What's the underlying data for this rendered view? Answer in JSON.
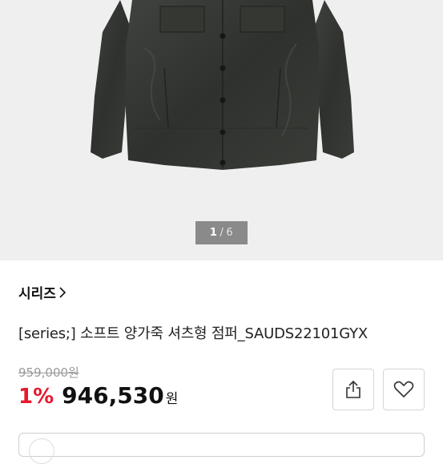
{
  "gallery": {
    "current": "1",
    "separator": "/",
    "total": "6",
    "image_subject": "charcoal leather shirt jacket"
  },
  "product": {
    "series_label": "시리즈",
    "title": "[series;] 소프트 양가죽 셔츠형 점퍼_SAUDS22101GYX",
    "original_price": "959,000원",
    "discount": "1%",
    "price": "946,530",
    "currency": "원"
  },
  "icons": {
    "share": "share-icon",
    "wishlist": "heart-icon",
    "series_arrow": "chevron-right-icon"
  },
  "colors": {
    "discount": "#e8192c",
    "gallery_bg": "#efefef",
    "pager_bg": "#8a8a8a"
  }
}
